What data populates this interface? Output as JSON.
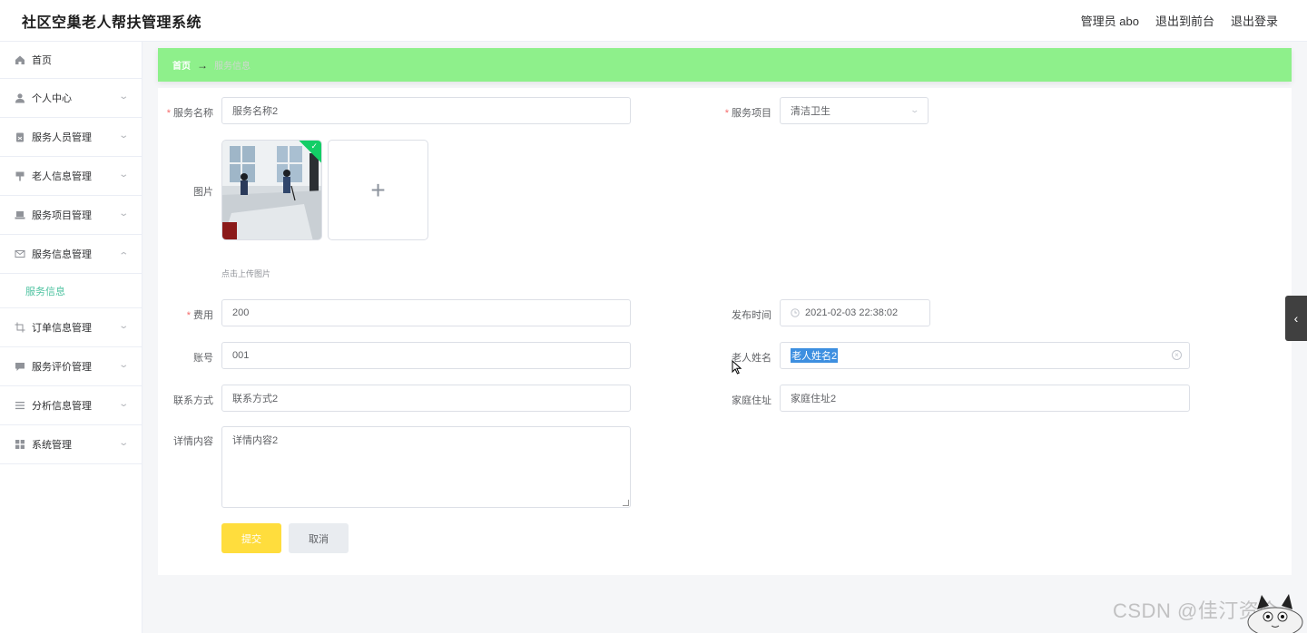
{
  "app": {
    "title": "社区空巢老人帮扶管理系统",
    "user": "管理员 abo",
    "goto_front": "退出到前台",
    "logout": "退出登录"
  },
  "sidebar": {
    "items": [
      {
        "label": "首页",
        "icon": "home-icon"
      },
      {
        "label": "个人中心",
        "icon": "user-icon"
      },
      {
        "label": "服务人员管理",
        "icon": "clipboard-icon"
      },
      {
        "label": "老人信息管理",
        "icon": "sign-icon"
      },
      {
        "label": "服务项目管理",
        "icon": "laptop-icon"
      },
      {
        "label": "服务信息管理",
        "icon": "mail-icon"
      },
      {
        "label": "订单信息管理",
        "icon": "crop-icon"
      },
      {
        "label": "服务评价管理",
        "icon": "chat-icon"
      },
      {
        "label": "分析信息管理",
        "icon": "list-icon"
      },
      {
        "label": "系统管理",
        "icon": "grid-icon"
      }
    ],
    "submenu_active": "服务信息"
  },
  "breadcrumb": {
    "home": "首页",
    "separator": "→",
    "current": "服务信息"
  },
  "form": {
    "service_name": {
      "label": "服务名称",
      "value": "服务名称2"
    },
    "service_item": {
      "label": "服务项目",
      "value": "清洁卫生"
    },
    "image": {
      "label": "图片",
      "tip": "点击上传图片",
      "add": "+"
    },
    "fee": {
      "label": "费用",
      "value": "200"
    },
    "publish_time": {
      "label": "发布时间",
      "value": "2021-02-03 22:38:02"
    },
    "account": {
      "label": "账号",
      "value": "001"
    },
    "elder_name": {
      "label": "老人姓名",
      "value": "老人姓名2"
    },
    "contact": {
      "label": "联系方式",
      "value": "联系方式2"
    },
    "address": {
      "label": "家庭住址",
      "value": "家庭住址2"
    },
    "detail": {
      "label": "详情内容",
      "value": "详情内容2"
    },
    "required_mark": "*",
    "submit": "提交",
    "cancel": "取消"
  },
  "watermark": "CSDN @佳汀资合",
  "colors": {
    "breadcrumb_bg": "#8ef08b",
    "submit_bg": "#ffdd3d",
    "active_submenu": "#4fc3a1",
    "success_badge": "#13ce66"
  }
}
